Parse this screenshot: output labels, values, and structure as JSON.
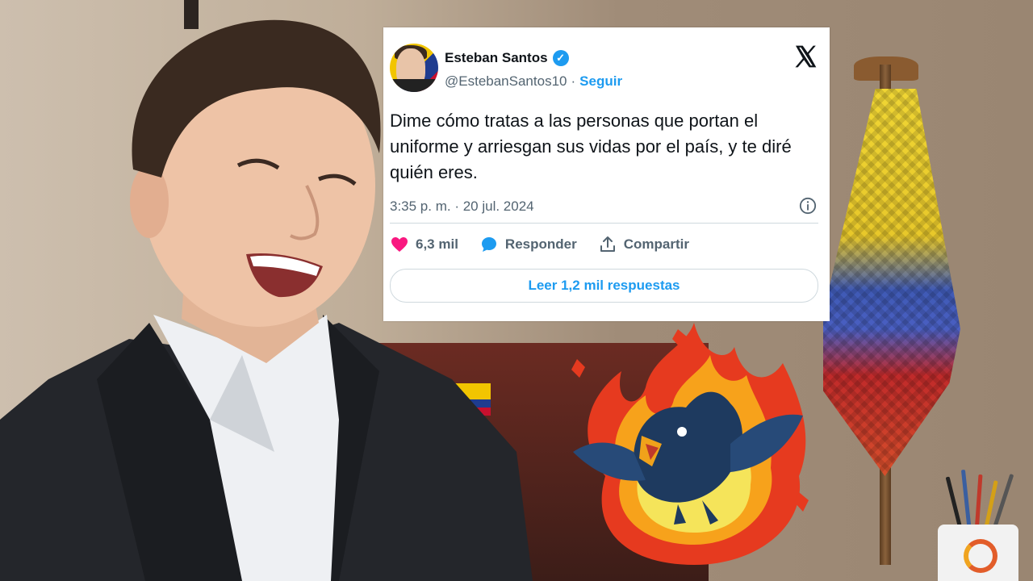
{
  "tweet": {
    "author_name": "Esteban Santos",
    "handle": "@EstebanSantos10",
    "separator": "·",
    "follow_label": "Seguir",
    "text": "Dime cómo tratas a las personas que portan el uniforme y arriesgan sus vidas por el país, y te diré quién eres.",
    "timestamp": "3:35 p. m. · 20 jul. 2024",
    "likes": "6,3 mil",
    "reply_label": "Responder",
    "share_label": "Compartir",
    "read_replies_label": "Leer 1,2 mil respuestas"
  },
  "icons": {
    "verified": "verified-badge-icon",
    "platform": "x-logo-icon",
    "info": "info-icon",
    "like": "heart-icon",
    "reply": "speech-bubble-icon",
    "share": "share-upload-icon"
  },
  "colors": {
    "accent": "#1d9bf0",
    "like": "#f91880",
    "text": "#0f1419",
    "muted": "#536471"
  }
}
